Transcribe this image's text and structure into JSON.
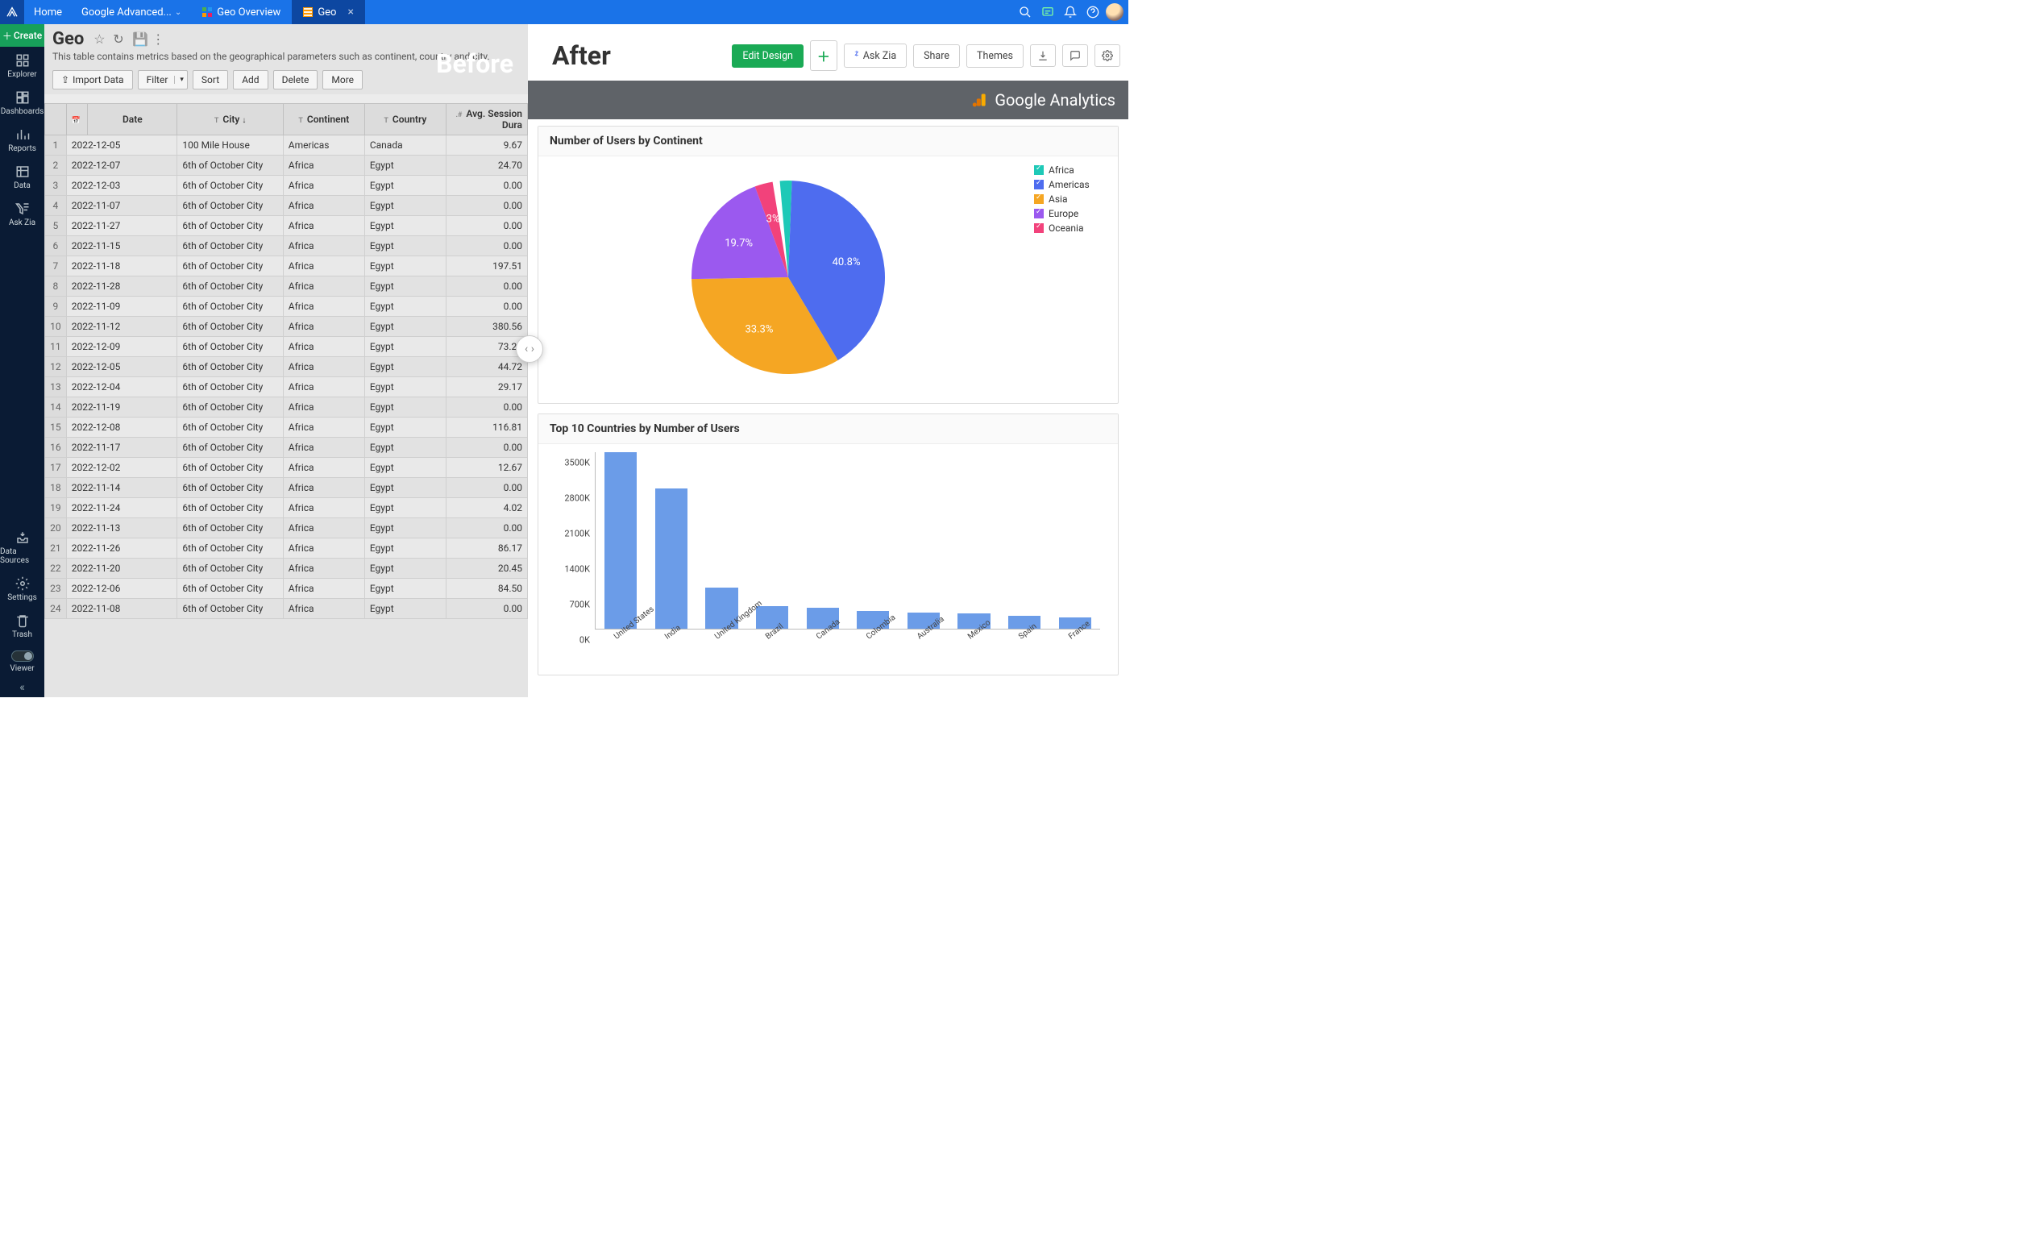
{
  "topbar": {
    "home": "Home",
    "breadcrumb": "Google Advanced...",
    "tab1": "Geo Overview",
    "tab2": "Geo"
  },
  "leftnav": {
    "create": "Create",
    "items": [
      {
        "label": "Explorer"
      },
      {
        "label": "Dashboards"
      },
      {
        "label": "Reports"
      },
      {
        "label": "Data"
      },
      {
        "label": "Ask Zia"
      }
    ],
    "bottom": [
      {
        "label": "Data Sources"
      },
      {
        "label": "Settings"
      },
      {
        "label": "Trash"
      }
    ],
    "viewer": "Viewer"
  },
  "leftpane": {
    "title": "Geo",
    "desc": "This table contains metrics based on the geographical parameters such as continent, country and city.",
    "buttons": {
      "import": "Import Data",
      "filter": "Filter",
      "sort": "Sort",
      "add": "Add",
      "delete": "Delete",
      "more": "More"
    },
    "columns": [
      "",
      "",
      "Date",
      "City",
      "Continent",
      "Country",
      "Avg. Session Dura"
    ],
    "col_type_hints": [
      "",
      "📅",
      "",
      "T",
      "T",
      "T",
      ".#"
    ],
    "rows": [
      [
        "1",
        "2022-12-05",
        "100 Mile House",
        "Americas",
        "Canada",
        "9.67"
      ],
      [
        "2",
        "2022-12-07",
        "6th of October City",
        "Africa",
        "Egypt",
        "24.70"
      ],
      [
        "3",
        "2022-12-03",
        "6th of October City",
        "Africa",
        "Egypt",
        "0.00"
      ],
      [
        "4",
        "2022-11-07",
        "6th of October City",
        "Africa",
        "Egypt",
        "0.00"
      ],
      [
        "5",
        "2022-11-27",
        "6th of October City",
        "Africa",
        "Egypt",
        "0.00"
      ],
      [
        "6",
        "2022-11-15",
        "6th of October City",
        "Africa",
        "Egypt",
        "0.00"
      ],
      [
        "7",
        "2022-11-18",
        "6th of October City",
        "Africa",
        "Egypt",
        "197.51"
      ],
      [
        "8",
        "2022-11-28",
        "6th of October City",
        "Africa",
        "Egypt",
        "0.00"
      ],
      [
        "9",
        "2022-11-09",
        "6th of October City",
        "Africa",
        "Egypt",
        "0.00"
      ],
      [
        "10",
        "2022-11-12",
        "6th of October City",
        "Africa",
        "Egypt",
        "380.56"
      ],
      [
        "11",
        "2022-12-09",
        "6th of October City",
        "Africa",
        "Egypt",
        "73.20"
      ],
      [
        "12",
        "2022-12-05",
        "6th of October City",
        "Africa",
        "Egypt",
        "44.72"
      ],
      [
        "13",
        "2022-12-04",
        "6th of October City",
        "Africa",
        "Egypt",
        "29.17"
      ],
      [
        "14",
        "2022-11-19",
        "6th of October City",
        "Africa",
        "Egypt",
        "0.00"
      ],
      [
        "15",
        "2022-12-08",
        "6th of October City",
        "Africa",
        "Egypt",
        "116.81"
      ],
      [
        "16",
        "2022-11-17",
        "6th of October City",
        "Africa",
        "Egypt",
        "0.00"
      ],
      [
        "17",
        "2022-12-02",
        "6th of October City",
        "Africa",
        "Egypt",
        "12.67"
      ],
      [
        "18",
        "2022-11-14",
        "6th of October City",
        "Africa",
        "Egypt",
        "0.00"
      ],
      [
        "19",
        "2022-11-24",
        "6th of October City",
        "Africa",
        "Egypt",
        "4.02"
      ],
      [
        "20",
        "2022-11-13",
        "6th of October City",
        "Africa",
        "Egypt",
        "0.00"
      ],
      [
        "21",
        "2022-11-26",
        "6th of October City",
        "Africa",
        "Egypt",
        "86.17"
      ],
      [
        "22",
        "2022-11-20",
        "6th of October City",
        "Africa",
        "Egypt",
        "20.45"
      ],
      [
        "23",
        "2022-12-06",
        "6th of October City",
        "Africa",
        "Egypt",
        "84.50"
      ],
      [
        "24",
        "2022-11-08",
        "6th of October City",
        "Africa",
        "Egypt",
        "0.00"
      ]
    ]
  },
  "labels": {
    "before": "Before",
    "after": "After"
  },
  "rightpane": {
    "buttons": {
      "edit": "Edit Design",
      "askzia": "Ask Zia",
      "share": "Share",
      "themes": "Themes"
    },
    "ga_brand": "Google Analytics",
    "pie_title": "Number of Users by Continent",
    "bar_title": "Top 10 Countries by Number of Users"
  },
  "chart_data": [
    {
      "type": "pie",
      "title": "Number of Users by Continent",
      "series": [
        {
          "name": "Africa",
          "value": 2.0,
          "color": "#1ec9b7",
          "label": ""
        },
        {
          "name": "Americas",
          "value": 40.8,
          "color": "#4e6cef",
          "label": "40.8%"
        },
        {
          "name": "Asia",
          "value": 33.3,
          "color": "#f5a623",
          "label": "33.3%"
        },
        {
          "name": "Europe",
          "value": 19.7,
          "color": "#9b59ef",
          "label": "19.7%"
        },
        {
          "name": "Oceania",
          "value": 3.0,
          "color": "#f2427b",
          "label": "3%"
        }
      ]
    },
    {
      "type": "bar",
      "title": "Top 10 Countries by Number of Users",
      "ylabel": "",
      "ylim": [
        0,
        3500
      ],
      "yticks": [
        "0K",
        "700K",
        "1400K",
        "2100K",
        "2800K",
        "3500K"
      ],
      "categories": [
        "United States",
        "India",
        "United Kingdom",
        "Brazil",
        "Canada",
        "Colombia",
        "Australia",
        "Mexico",
        "Spain",
        "France"
      ],
      "values": [
        3500,
        2780,
        820,
        450,
        420,
        350,
        320,
        300,
        260,
        230
      ],
      "color": "#6b9ce8"
    }
  ]
}
